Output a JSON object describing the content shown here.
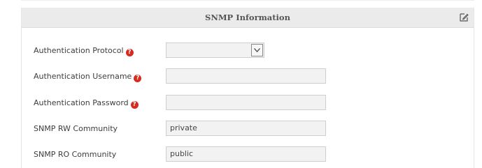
{
  "panel": {
    "title": "SNMP Information",
    "edit_icon": "edit-icon"
  },
  "fields": [
    {
      "label": "Authentication Protocol",
      "help": true,
      "help_icon": "help-icon",
      "type": "select",
      "value": "",
      "dropdown_icon": "chevron-down-icon"
    },
    {
      "label": "Authentication Username",
      "help": true,
      "help_icon": "help-icon",
      "type": "text",
      "value": ""
    },
    {
      "label": "Authentication Password",
      "help": true,
      "help_icon": "help-icon",
      "type": "text",
      "value": ""
    },
    {
      "label": "SNMP RW Community",
      "help": false,
      "type": "text",
      "value": "private"
    },
    {
      "label": "SNMP RO Community",
      "help": false,
      "type": "text",
      "value": "public"
    }
  ],
  "help_glyph": "?",
  "colors": {
    "header_bg": "#ebebeb",
    "help_icon": "#d62b1f",
    "field_bg": "#f2f2f2",
    "field_border": "#cfcfcf"
  }
}
